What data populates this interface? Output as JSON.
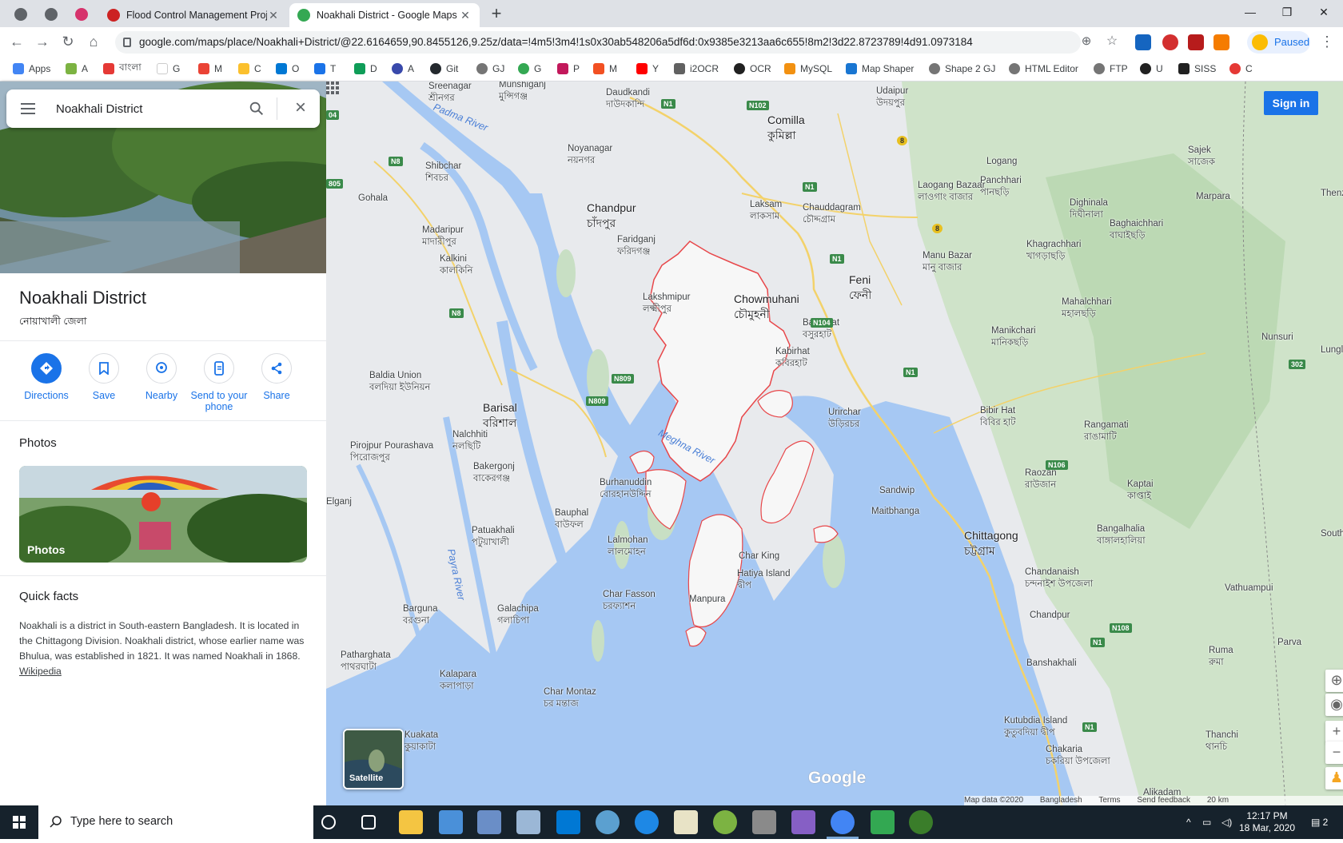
{
  "browser": {
    "tabs": [
      {
        "title": "Flood Control Management Proje",
        "active": false
      },
      {
        "title": "Noakhali District - Google Maps",
        "active": true
      }
    ],
    "url": "google.com/maps/place/Noakhali+District/@22.6164659,90.8455126,9.25z/data=!4m5!3m4!1s0x30ab548206a5df6d:0x9385e3213aa6c655!8m2!3d22.8723789!4d91.0973184",
    "profile_label": "Paused",
    "bookmarks": [
      "Apps",
      "A",
      "বাংলা",
      "G",
      "M",
      "C",
      "O",
      "T",
      "D",
      "A",
      "Git",
      "GJ",
      "G",
      "P",
      "M",
      "Y",
      "i2OCR",
      "OCR",
      "MySQL",
      "Map Shaper",
      "Shape 2 GJ",
      "HTML Editor",
      "FTP",
      "U",
      "SISS",
      "C"
    ]
  },
  "search": {
    "value": "Noakhali District"
  },
  "place": {
    "title": "Noakhali District",
    "subtitle": "নোয়াখালী জেলা",
    "actions": [
      "Directions",
      "Save",
      "Nearby",
      "Send to your phone",
      "Share"
    ],
    "photos_heading": "Photos",
    "photo_label": "Photos",
    "quick_facts_heading": "Quick facts",
    "quick_facts_text": "Noakhali is a district in South-eastern Bangladesh. It is located in the Chittagong Division. Noakhali district, whose earlier name was Bhulua, was established in 1821. It was named Noakhali in 1868.",
    "quick_facts_link": "Wikipedia"
  },
  "map": {
    "sign_in": "Sign in",
    "satellite_label": "Satellite",
    "logo": "Google",
    "footer": [
      "Map data ©2020",
      "Bangladesh",
      "Terms",
      "Send feedback",
      "20 km"
    ],
    "places": [
      "Sreenagar",
      "শ্রীনগর",
      "Munshiganj",
      "মুন্সিগঞ্জ",
      "Daudkandi",
      "দাউদকান্দি",
      "Comilla",
      "কুমিল্লা",
      "Udaipur",
      "উদয়পুর",
      "Noyanagar",
      "নয়নগর",
      "Shibchar",
      "শিবচর",
      "Gohala",
      "Chandpur",
      "চাঁদপুর",
      "Laksam",
      "লাকসাম",
      "Chauddagram",
      "চৌদ্দগ্রাম",
      "Logang",
      "Laogang Bazaar",
      "লাওগাং বাজার",
      "Panchhari",
      "পানছড়ি",
      "Sajek",
      "সাজেক",
      "Dighinala",
      "দিঘীনালা",
      "Marpara",
      "Madaripur",
      "মাদারীপুর",
      "Faridganj",
      "ফরিদগঞ্জ",
      "Kalkini",
      "কালকিনি",
      "Baghaichhari",
      "বাঘাইছড়ি",
      "Khagrachhari",
      "খাগড়াছড়ি",
      "Manu Bazar",
      "মানু বাজার",
      "Feni",
      "ফেনী",
      "Chowmuhani",
      "চৌমুহনী",
      "Lakshmipur",
      "লক্ষ্মীপুর",
      "Mahalchhari",
      "মহালছড়ি",
      "Basurhat",
      "বসুরহাট",
      "Kabirhat",
      "কবিরহাট",
      "Manikchari",
      "মানিকছড়ি",
      "Baldia Union",
      "বলদিয়া ইউনিয়ন",
      "Nunsuri",
      "Urirchar",
      "উড়িরচর",
      "Barisal",
      "বরিশাল",
      "Bibir Hat",
      "বিবির হাট",
      "Rangamati",
      "রাঙামাটি",
      "Nalchhiti",
      "নলছিটি",
      "Pirojpur Pourashava",
      "পিরোজপুর",
      "Bakergonj",
      "বাকেরগঞ্জ",
      "Meghna River",
      "Burhanuddin",
      "বোরহানউদ্দিন",
      "Sandwip",
      "Maitbhanga",
      "Raozan",
      "রাউজান",
      "Kaptai",
      "কাপ্তাই",
      "Bauphal",
      "বাউফল",
      "Patuakhali",
      "পটুয়াখালী",
      "Chittagong",
      "চট্টগ্রাম",
      "Bangalhalia",
      "বাঙ্গালহালিয়া",
      "Char King",
      "Lalmohan",
      "লালমোহন",
      "Hatiya Island",
      "দ্বীপ",
      "Chandanaish",
      "চন্দনাইশ উপজেলা",
      "Manpura",
      "Char Fasson",
      "চরফ্যাশন",
      "Galachipa",
      "গলাচিপা",
      "Barguna",
      "বরগুনা",
      "Vathuampui",
      "Chandpur",
      "Patharghata",
      "পাথরঘাটা",
      "Ruma",
      "রুমা",
      "Parva",
      "Banshakhali",
      "Kalapara",
      "কলাপাড়া",
      "Char Montaz",
      "চর মন্তাজ",
      "Kutubdia Island",
      "কুতুবদিয়া দ্বীপ",
      "Thanchi",
      "থানচি",
      "Kuakata",
      "কুয়াকাটা",
      "Chakaria",
      "চকরিয়া উপজেলা",
      "Alikadam",
      "Padma River",
      "Payra River",
      "Elganj",
      "Lungle",
      "South Bungtla",
      "Thenz"
    ],
    "roads": [
      "N1",
      "N102",
      "N8",
      "805",
      "N809",
      "N104",
      "N106",
      "N108",
      "302",
      "8",
      "04"
    ]
  },
  "taskbar": {
    "search_placeholder": "Type here to search",
    "time": "12:17 PM",
    "date": "18 Mar, 2020",
    "notifications": "2"
  },
  "colors": {
    "accent": "#1a73e8",
    "district_border": "#e8474a",
    "water": "#a0c4f0",
    "land": "#e8eaed",
    "green": "#c8dfc4"
  }
}
